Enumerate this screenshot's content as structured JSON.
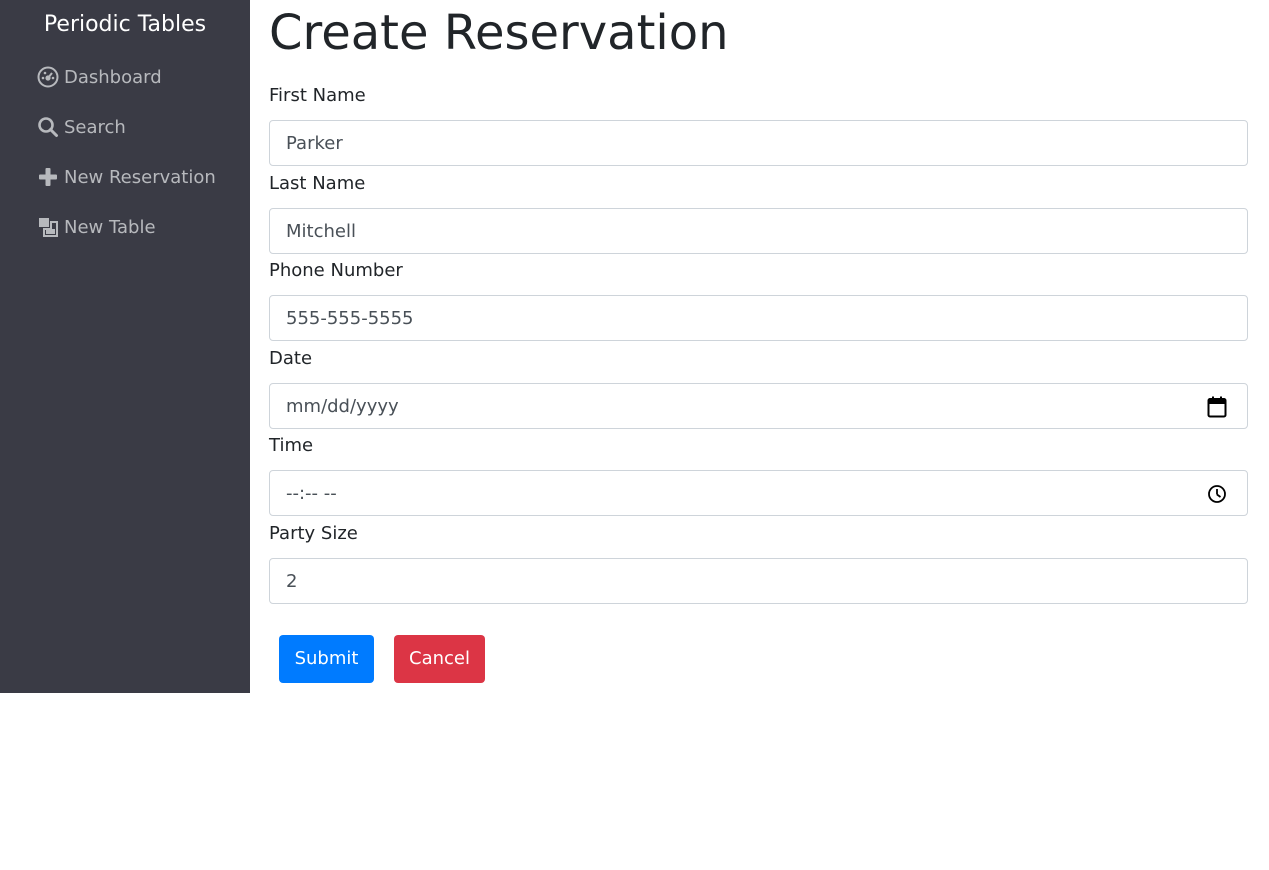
{
  "sidebar": {
    "brand": "Periodic Tables",
    "items": [
      {
        "label": "Dashboard",
        "icon": "dashboard-icon"
      },
      {
        "label": "Search",
        "icon": "search-icon"
      },
      {
        "label": "New Reservation",
        "icon": "plus-icon"
      },
      {
        "label": "New Table",
        "icon": "layers-icon"
      }
    ]
  },
  "main": {
    "title": "Create Reservation",
    "fields": {
      "first_name": {
        "label": "First Name",
        "value": "Parker"
      },
      "last_name": {
        "label": "Last Name",
        "value": "Mitchell"
      },
      "phone": {
        "label": "Phone Number",
        "value": "555-555-5555"
      },
      "date": {
        "label": "Date",
        "value": "mm/dd/yyyy"
      },
      "time": {
        "label": "Time",
        "value": "--:-- --"
      },
      "party_size": {
        "label": "Party Size",
        "value": "2"
      }
    },
    "buttons": {
      "submit": "Submit",
      "cancel": "Cancel"
    }
  },
  "colors": {
    "sidebar_bg": "#3a3b45",
    "submit": "#007bff",
    "cancel": "#dc3545"
  }
}
